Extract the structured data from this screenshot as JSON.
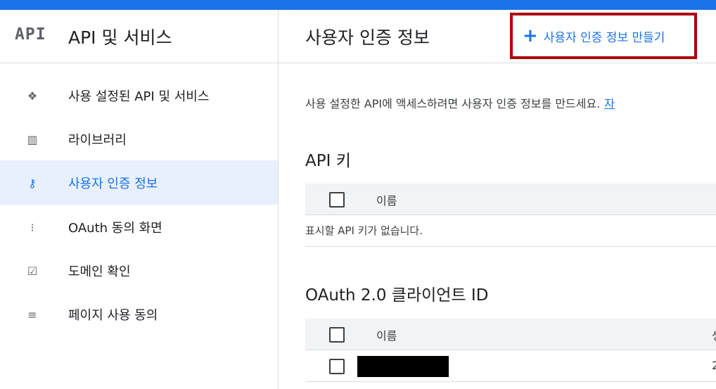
{
  "colors": {
    "accent": "#1a73e8",
    "highlight": "#b00000",
    "active_bg": "#e8f0fe"
  },
  "sidebar": {
    "logo": "API",
    "title": "API 및 서비스",
    "items": [
      {
        "label": "사용 설정된 API 및 서비스",
        "icon": "dashboard-icon",
        "glyph": "❖",
        "active": false
      },
      {
        "label": "라이브러리",
        "icon": "library-icon",
        "glyph": "▥",
        "active": false
      },
      {
        "label": "사용자 인증 정보",
        "icon": "key-icon",
        "glyph": "⚷",
        "active": true
      },
      {
        "label": "OAuth 동의 화면",
        "icon": "consent-icon",
        "glyph": "⁝",
        "active": false
      },
      {
        "label": "도메인 확인",
        "icon": "checkbox-icon",
        "glyph": "☑",
        "active": false
      },
      {
        "label": "페이지 사용 동의",
        "icon": "settings-list-icon",
        "glyph": "≡",
        "active": false
      }
    ]
  },
  "header": {
    "title": "사용자 인증 정보",
    "create_label": "사용자 인증 정보 만들기",
    "create_icon": "+"
  },
  "main": {
    "description": "사용 설정한 API에 액세스하려면 사용자 인증 정보를 만드세요.",
    "description_link": "자",
    "api_keys": {
      "title": "API 키",
      "column_name": "이름",
      "empty_message": "표시할 API 키가 없습니다."
    },
    "oauth": {
      "title": "OAuth 2.0 클라이언트 ID",
      "column_name": "이름",
      "column_2_partial": "생",
      "row_partial": "2"
    }
  }
}
